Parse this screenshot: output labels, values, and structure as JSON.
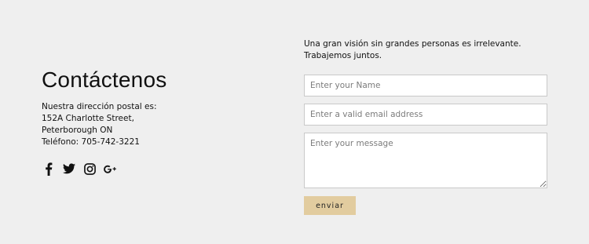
{
  "contact": {
    "title": "Contáctenos",
    "address_lines": [
      "Nuestra dirección postal es:",
      "152A Charlotte Street,",
      "Peterborough ON",
      "Teléfono: 705-742-3221"
    ]
  },
  "social": {
    "icons": [
      "facebook-icon",
      "twitter-icon",
      "instagram-icon",
      "google-plus-icon"
    ]
  },
  "intro": {
    "line1": "Una gran visión sin grandes personas es irrelevante.",
    "line2": "Trabajemos juntos."
  },
  "form": {
    "name_placeholder": "Enter your Name",
    "email_placeholder": "Enter a valid email address",
    "message_placeholder": "Enter your message",
    "submit_label": "enviar"
  },
  "colors": {
    "background": "#efefef",
    "button": "#e2cc9f",
    "text": "#111111"
  }
}
